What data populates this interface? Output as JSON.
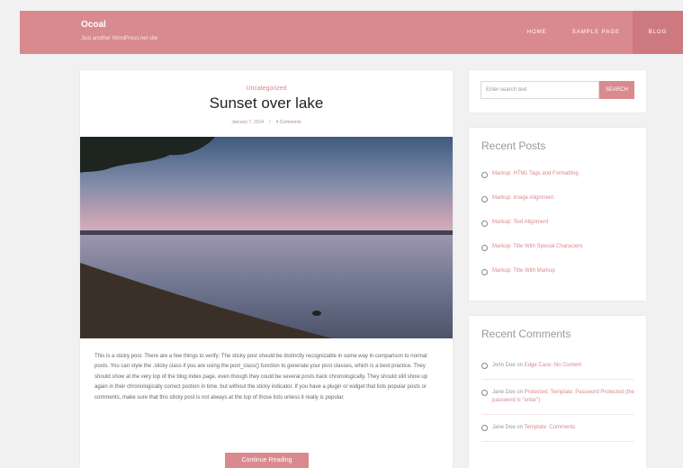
{
  "header": {
    "site_title": "Ocoal",
    "site_description": "Just another WordPress.net site",
    "nav": [
      "HOME",
      "SAMPLE PAGE",
      "BLOG"
    ]
  },
  "post": {
    "category": "Uncategorized",
    "title": "Sunset over lake",
    "date": "January 7, 2014",
    "comments": "4 Comments",
    "excerpt": "This is a sticky post. There are a few things to verify: The sticky post should be distinctly recognizable in some way in comparison to normal posts. You can style the .sticky class if you are using the post_class() function to generate your post classes, which is a best practice. They should show at the very top of the blog index page, even though they could be several posts back chronologically. They should still show up again in their chronologically correct postion in time, but without the sticky indicator. If you have a plugin or widget that lists popular posts or comments, make sure that this sticky post is not always at the top of those lists unless it really is popular.",
    "continue_label": "Continue Reading"
  },
  "search": {
    "placeholder": "Enter search text",
    "button_label": "SEARCH"
  },
  "recent_posts": {
    "title": "Recent Posts",
    "items": [
      "Markup: HTML Tags and Formatting",
      "Markup: Image Alignment",
      "Markup: Text Alignment",
      "Markup: Title With Special Characters",
      "Markup: Title With Markup"
    ]
  },
  "recent_comments": {
    "title": "Recent Comments",
    "items": [
      {
        "author": "John Doe",
        "on": "on",
        "post": "Edge Case: No Content"
      },
      {
        "author": "Jane Doe",
        "on": "on",
        "post": "Protected: Template: Password Protected (the password is \"enter\")"
      },
      {
        "author": "Jane Doe",
        "on": "on",
        "post": "Template: Comments"
      }
    ]
  },
  "colors": {
    "accent": "#d98a8f",
    "accent_dark": "#cc7a80",
    "background": "#f1f1f1"
  }
}
